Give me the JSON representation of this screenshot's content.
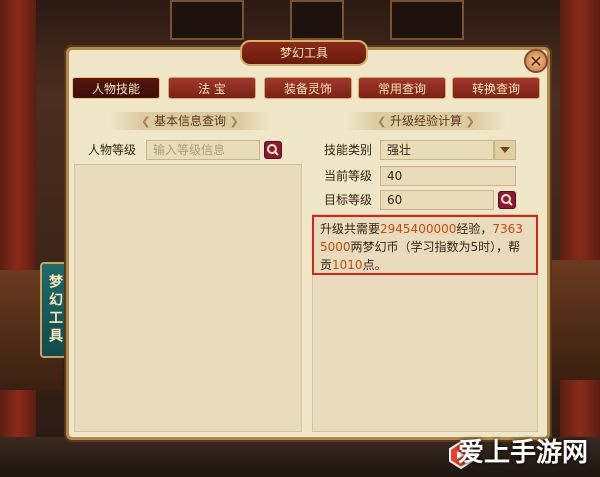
{
  "window": {
    "title": "梦幻工具",
    "side_tab": "梦幻工具"
  },
  "tabs": [
    {
      "label": "人物技能",
      "active": true
    },
    {
      "label": "法 宝",
      "active": false
    },
    {
      "label": "装备灵饰",
      "active": false
    },
    {
      "label": "常用查询",
      "active": false
    },
    {
      "label": "转换查询",
      "active": false
    }
  ],
  "left": {
    "section_title": "基本信息查询",
    "level_label": "人物等级",
    "level_placeholder": "输入等级信息"
  },
  "right": {
    "section_title": "升级经验计算",
    "skill_type_label": "技能类别",
    "skill_type_value": "强壮",
    "current_level_label": "当前等级",
    "current_level_value": "40",
    "target_level_label": "目标等级",
    "target_level_value": "60",
    "result": {
      "prefix": "升级共需要",
      "exp": "2945400000",
      "mid1": "经验，",
      "money": "73635000",
      "mid2": "两梦幻币（学习指数为5时），帮贡",
      "contrib": "1010",
      "suffix": "点。"
    }
  },
  "watermark": "爱上手游网",
  "colors": {
    "accent": "#d62418",
    "highlight": "#c84a10",
    "tab": "#8a2a18"
  }
}
